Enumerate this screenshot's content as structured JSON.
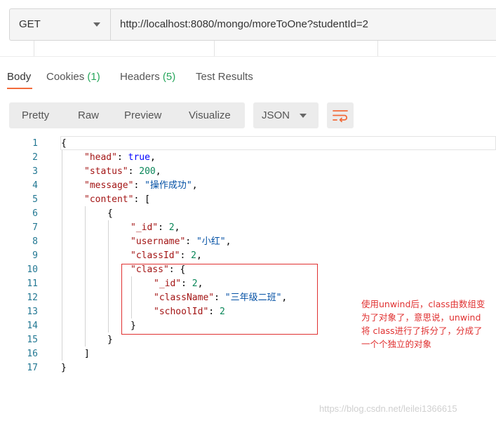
{
  "request": {
    "method": "GET",
    "url": "http://localhost:8080/mongo/moreToOne?studentId=2"
  },
  "response_tabs": [
    {
      "label": "Body",
      "count": ""
    },
    {
      "label": "Cookies",
      "count": "(1)"
    },
    {
      "label": "Headers",
      "count": "(5)"
    },
    {
      "label": "Test Results",
      "count": ""
    }
  ],
  "view_modes": [
    "Pretty",
    "Raw",
    "Preview",
    "Visualize"
  ],
  "format": "JSON",
  "code_lines": [
    {
      "n": "1"
    },
    {
      "n": "2"
    },
    {
      "n": "3"
    },
    {
      "n": "4"
    },
    {
      "n": "5"
    },
    {
      "n": "6"
    },
    {
      "n": "7"
    },
    {
      "n": "8"
    },
    {
      "n": "9"
    },
    {
      "n": "10"
    },
    {
      "n": "11"
    },
    {
      "n": "12"
    },
    {
      "n": "13"
    },
    {
      "n": "14"
    },
    {
      "n": "15"
    },
    {
      "n": "16"
    },
    {
      "n": "17"
    }
  ],
  "json": {
    "open_brace": "{",
    "close_brace": "}",
    "head_key": "\"head\"",
    "head_val": "true",
    "status_key": "\"status\"",
    "status_val": "200",
    "message_key": "\"message\"",
    "message_val": "\"操作成功\"",
    "content_key": "\"content\"",
    "content_open": "[",
    "content_close": "]",
    "obj_open": "{",
    "obj_close": "}",
    "id_key": "\"_id\"",
    "id_val": "2",
    "username_key": "\"username\"",
    "username_val": "\"小红\"",
    "classid_key": "\"classId\"",
    "classid_val": "2",
    "class_key": "\"class\"",
    "class_id_key": "\"_id\"",
    "class_id_val": "2",
    "classname_key": "\"className\"",
    "classname_val": "\"三年级二班\"",
    "schoolid_key": "\"schoolId\"",
    "schoolid_val": "2"
  },
  "annotation": {
    "lines": [
      "使用unwind后，class由数组变",
      "为了对象了，意思说，unwind",
      "将 class进行了拆分了，分成了",
      "一个个独立的对象"
    ]
  },
  "watermark": "https://blog.csdn.net/leilei1366615",
  "colors": {
    "accent": "#f26b3a",
    "count": "#26a65b",
    "annotation": "#e03030"
  }
}
